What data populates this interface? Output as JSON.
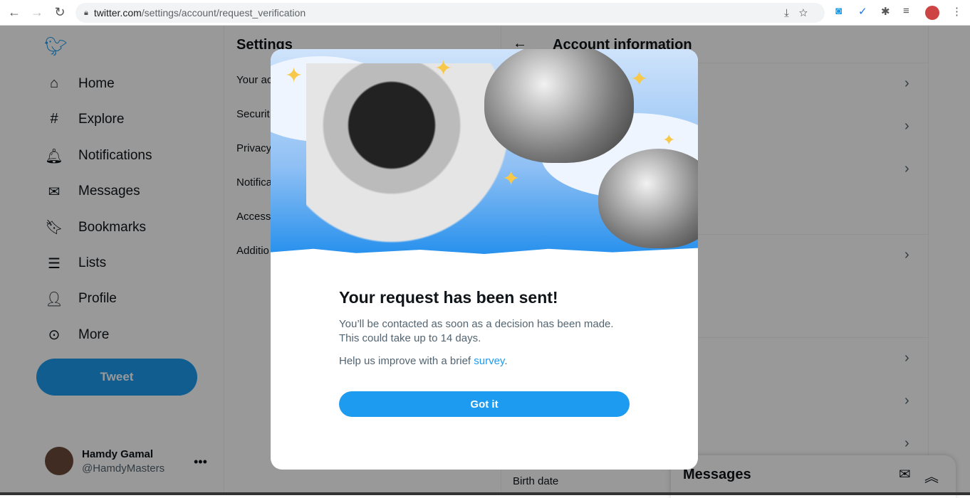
{
  "browser": {
    "url_domain": "twitter.com",
    "url_path": "/settings/account/request_verification"
  },
  "sidebar": {
    "items": [
      {
        "label": "Home",
        "icon": "home-icon",
        "glyph": "⌂"
      },
      {
        "label": "Explore",
        "icon": "hashtag-icon",
        "glyph": "#"
      },
      {
        "label": "Notifications",
        "icon": "bell-icon",
        "glyph": "🔔︎"
      },
      {
        "label": "Messages",
        "icon": "envelope-icon",
        "glyph": "✉"
      },
      {
        "label": "Bookmarks",
        "icon": "bookmark-icon",
        "glyph": "🔖︎"
      },
      {
        "label": "Lists",
        "icon": "list-icon",
        "glyph": "☰"
      },
      {
        "label": "Profile",
        "icon": "person-icon",
        "glyph": "👤︎"
      },
      {
        "label": "More",
        "icon": "more-circle-icon",
        "glyph": "⊙"
      }
    ],
    "tweet_label": "Tweet",
    "user": {
      "name": "Hamdy Gamal",
      "handle": "@HamdyMasters"
    }
  },
  "settings": {
    "title": "Settings",
    "items": [
      "Your ac",
      "Securit",
      "Privacy",
      "Notifica",
      "Access",
      "Additio"
    ]
  },
  "account": {
    "title": "Account information",
    "birth_date_label": "Birth date"
  },
  "messages_drawer": {
    "title": "Messages"
  },
  "modal": {
    "title": "Your request has been sent!",
    "line1": "You’ll be contacted as soon as a decision has been made.",
    "line2": "This could take up to 14 days.",
    "survey_prefix": "Help us improve with a brief ",
    "survey_link": "survey",
    "survey_suffix": ".",
    "button": "Got it"
  },
  "colors": {
    "accent": "#1d9bf0"
  }
}
